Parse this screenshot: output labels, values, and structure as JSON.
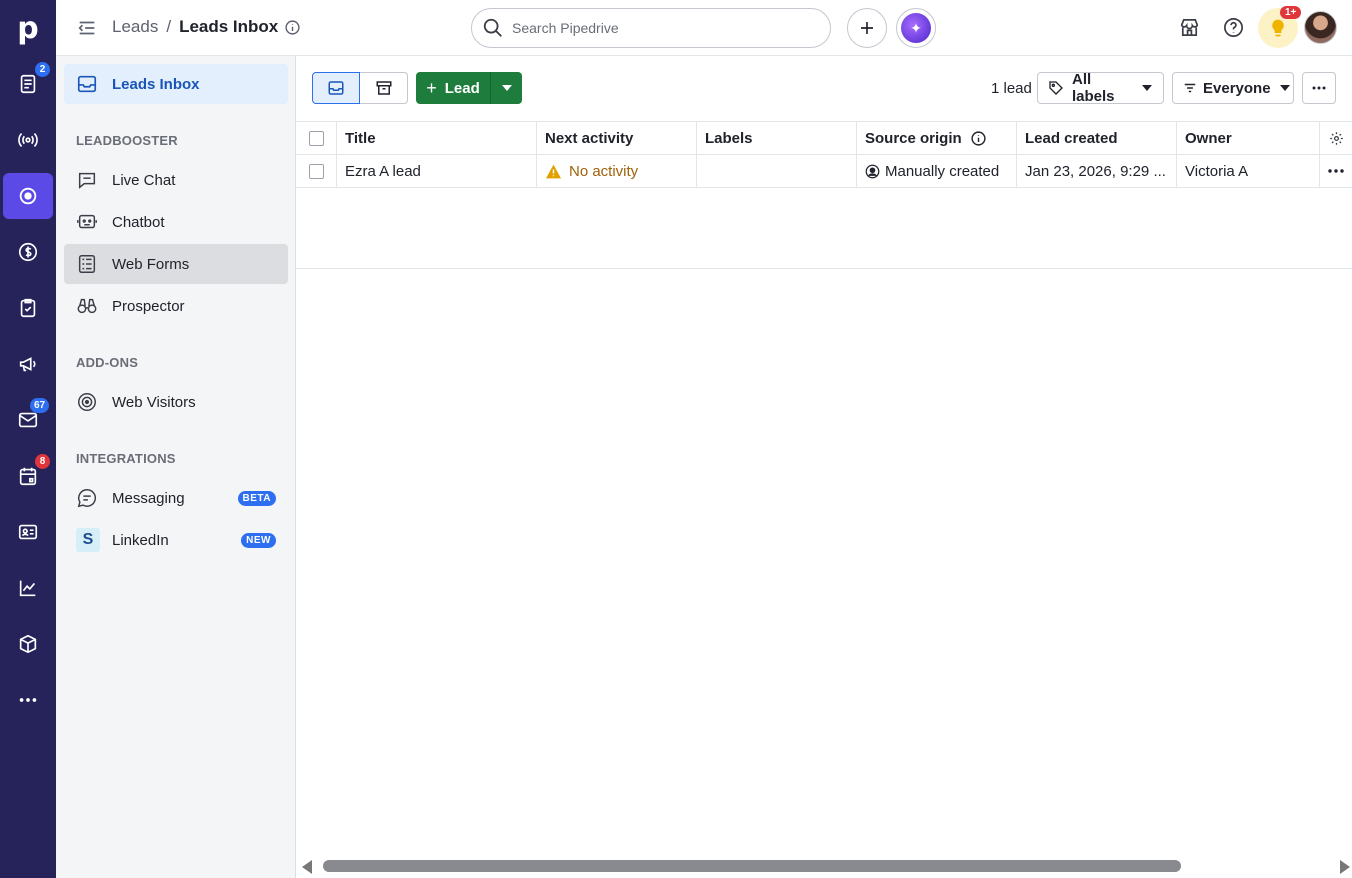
{
  "app": {
    "logo": "p"
  },
  "rail": {
    "badges": {
      "leads": "2",
      "mail": "67",
      "calendar": "8"
    }
  },
  "header": {
    "breadcrumb_parent": "Leads",
    "breadcrumb_sep": "/",
    "breadcrumb_current": "Leads Inbox",
    "search_placeholder": "Search Pipedrive",
    "notifications_badge": "1+"
  },
  "sidebar": {
    "inbox": "Leads Inbox",
    "section_leadbooster": "LEADBOOSTER",
    "live_chat": "Live Chat",
    "chatbot": "Chatbot",
    "web_forms": "Web Forms",
    "prospector": "Prospector",
    "section_addons": "ADD-ONS",
    "web_visitors": "Web Visitors",
    "section_integrations": "INTEGRATIONS",
    "messaging": "Messaging",
    "messaging_badge": "BETA",
    "linkedin": "LinkedIn",
    "linkedin_badge": "NEW"
  },
  "toolbar": {
    "lead_button": "Lead",
    "lead_count": "1 lead",
    "labels_filter": "All labels",
    "owner_filter": "Everyone"
  },
  "table": {
    "columns": [
      "Title",
      "Next activity",
      "Labels",
      "Source origin",
      "Lead created",
      "Owner"
    ],
    "rows": [
      {
        "title": "Ezra A lead",
        "next_activity": "No activity",
        "labels": "",
        "source_origin": "Manually created",
        "lead_created": "Jan 23, 2026, 9:29 ...",
        "owner": "Victoria A"
      }
    ]
  },
  "colors": {
    "rail": "#26235b",
    "active_rail": "#5b4ae6",
    "primary_green": "#1e7d3c",
    "link_blue": "#1a56b8"
  }
}
